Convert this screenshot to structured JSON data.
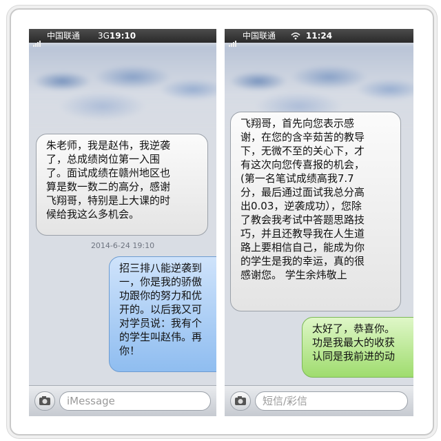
{
  "left": {
    "status": {
      "carrier": "中国联通",
      "network": "3G",
      "time": "19:10"
    },
    "incoming": "朱老师，我是赵伟，我逆袭\n了，总成绩岗位第一入围\n了。面试成绩在赣州地区也\n算是数一数二的高分，感谢\n飞翔哥，特别是上大课的时\n候给我这么多机会。",
    "timestamp": "2014-6-24 19:10",
    "outgoing": "招三排八能逆袭到\n一，你是我的骄傲\n功跟你的努力和优\n开的。以后我又可\n对学员说：我有个\n的学生叫赵伟。再\n你！",
    "input_placeholder": "iMessage"
  },
  "right": {
    "status": {
      "carrier": "中国联通",
      "time": "11:24"
    },
    "incoming": "飞翔哥，首先向您表示感\n谢，在您的含辛茹苦的教导\n下，无微不至的关心下，才\n有这次向您传喜报的机会，\n(第一名笔试成绩高我7.7\n分，最后通过面试我总分高\n出0.03，逆袭成功），您除\n了教会我考试中答题思路技\n巧，并且还教导我在人生道\n路上要相信自己，能成为你\n的学生是我的幸运，真的很\n感谢您。  学生余炜敬上",
    "outgoing": "太好了，恭喜你。\n功是我最大的收获\n认同是我前进的动",
    "input_placeholder": "短信/彩信"
  },
  "colors": {
    "blue_bubble": "#8fbdf0",
    "green_bubble": "#9fdc6e",
    "gray_bubble": "#e4e4e4"
  }
}
